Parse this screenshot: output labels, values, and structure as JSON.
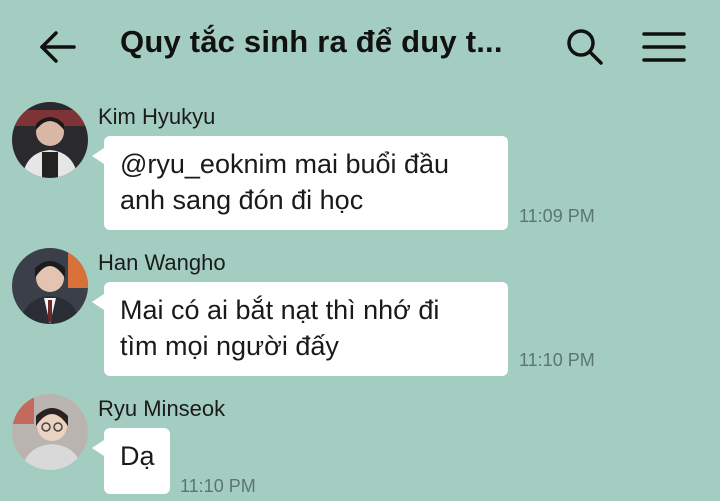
{
  "header": {
    "title": "Quy tắc sinh ra để duy t...",
    "back_icon": "arrow-left-icon",
    "search_icon": "search-icon",
    "menu_icon": "hamburger-menu-icon"
  },
  "messages": [
    {
      "sender": "Kim Hyukyu",
      "lines": [
        "@ryu_eoknim mai buổi đầu",
        "anh sang đón đi học"
      ],
      "time": "11:09 PM"
    },
    {
      "sender": "Han Wangho",
      "lines": [
        "Mai có ai bắt nạt thì nhớ đi",
        "tìm mọi người đấy"
      ],
      "time": "11:10 PM"
    },
    {
      "sender": "Ryu Minseok",
      "lines": [
        "Dạ"
      ],
      "time": "11:10 PM"
    }
  ]
}
